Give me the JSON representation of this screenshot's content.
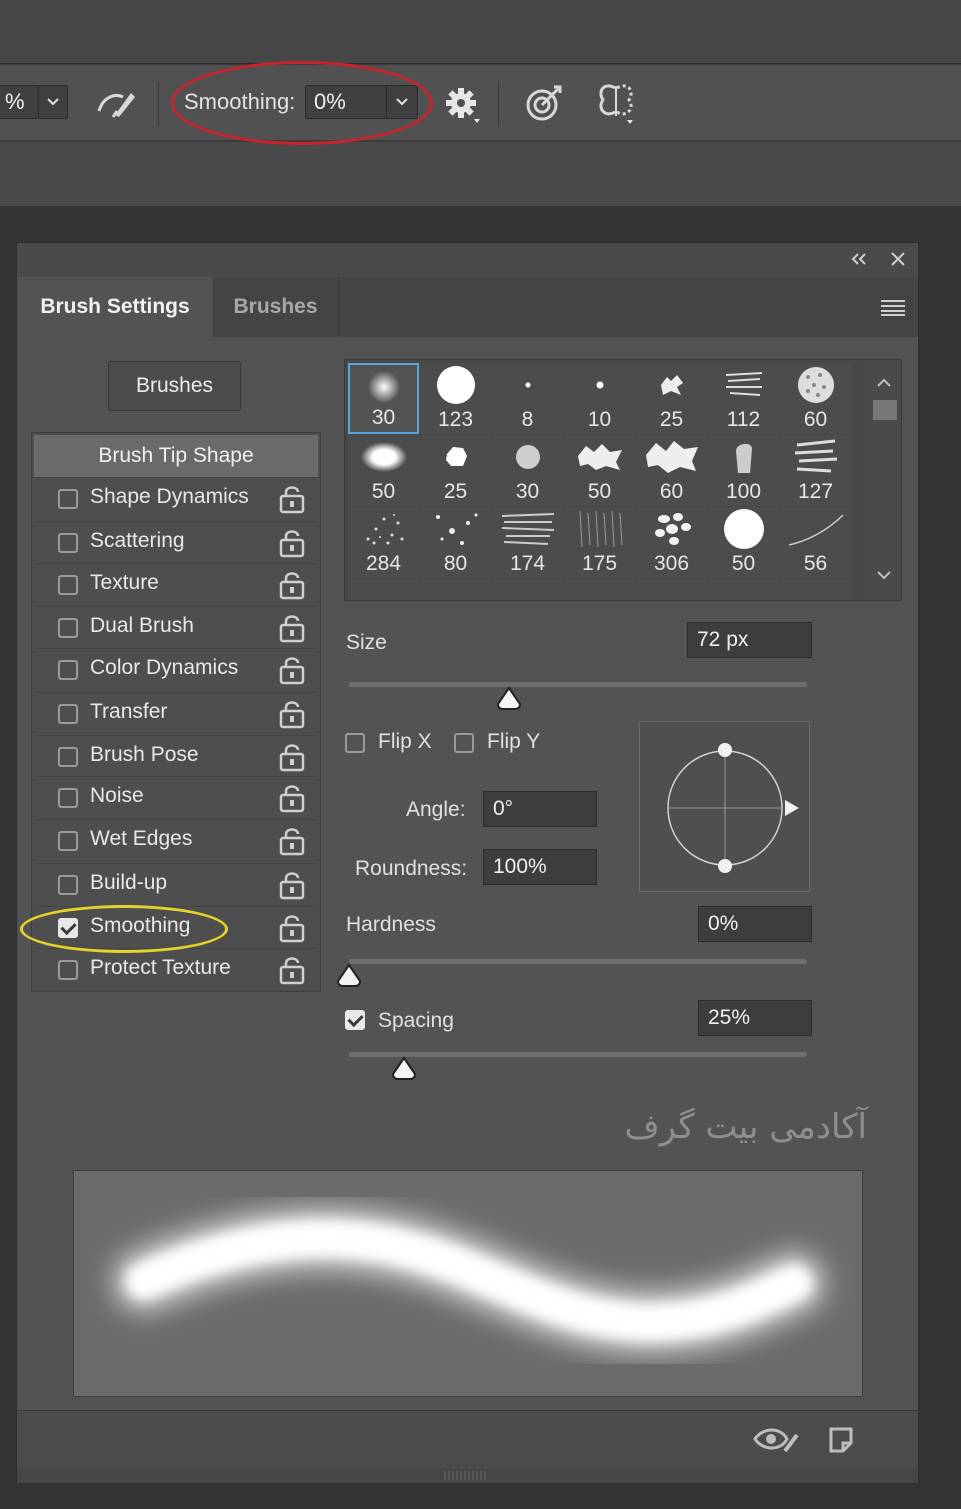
{
  "options_bar": {
    "percent_field": "%",
    "smoothing_label": "Smoothing:",
    "smoothing_value": "0%"
  },
  "panel": {
    "tabs": [
      {
        "label": "Brush Settings",
        "active": true
      },
      {
        "label": "Brushes",
        "active": false
      }
    ],
    "brushes_button": "Brushes",
    "tip_shape_label": "Brush Tip Shape",
    "options": [
      {
        "label": "Shape Dynamics",
        "checked": false
      },
      {
        "label": "Scattering",
        "checked": false
      },
      {
        "label": "Texture",
        "checked": false
      },
      {
        "label": "Dual Brush",
        "checked": false
      },
      {
        "label": "Color Dynamics",
        "checked": false
      },
      {
        "label": "Transfer",
        "checked": false
      },
      {
        "label": "Brush Pose",
        "checked": false
      },
      {
        "label": "Noise",
        "checked": false
      },
      {
        "label": "Wet Edges",
        "checked": false
      },
      {
        "label": "Build-up",
        "checked": false
      },
      {
        "label": "Smoothing",
        "checked": true
      },
      {
        "label": "Protect Texture",
        "checked": false
      }
    ],
    "tips": [
      "30",
      "123",
      "8",
      "10",
      "25",
      "112",
      "60",
      "50",
      "25",
      "30",
      "50",
      "60",
      "100",
      "127",
      "284",
      "80",
      "174",
      "175",
      "306",
      "50",
      "56"
    ],
    "size": {
      "label": "Size",
      "value": "72 px",
      "slider_fraction": 0.35
    },
    "flip_x": {
      "label": "Flip X",
      "checked": false
    },
    "flip_y": {
      "label": "Flip Y",
      "checked": false
    },
    "angle": {
      "label": "Angle:",
      "value": "0°"
    },
    "roundness": {
      "label": "Roundness:",
      "value": "100%"
    },
    "hardness": {
      "label": "Hardness",
      "value": "0%",
      "slider_fraction": 0.0
    },
    "spacing": {
      "label": "Spacing",
      "value": "25%",
      "checked": true,
      "slider_fraction": 0.12
    },
    "watermark": "آکادمی بیت گرف"
  },
  "colors": {
    "selection_outline": "#58a6d8",
    "annotation_red": "#c8232e",
    "annotation_yellow": "#e4d32a"
  }
}
